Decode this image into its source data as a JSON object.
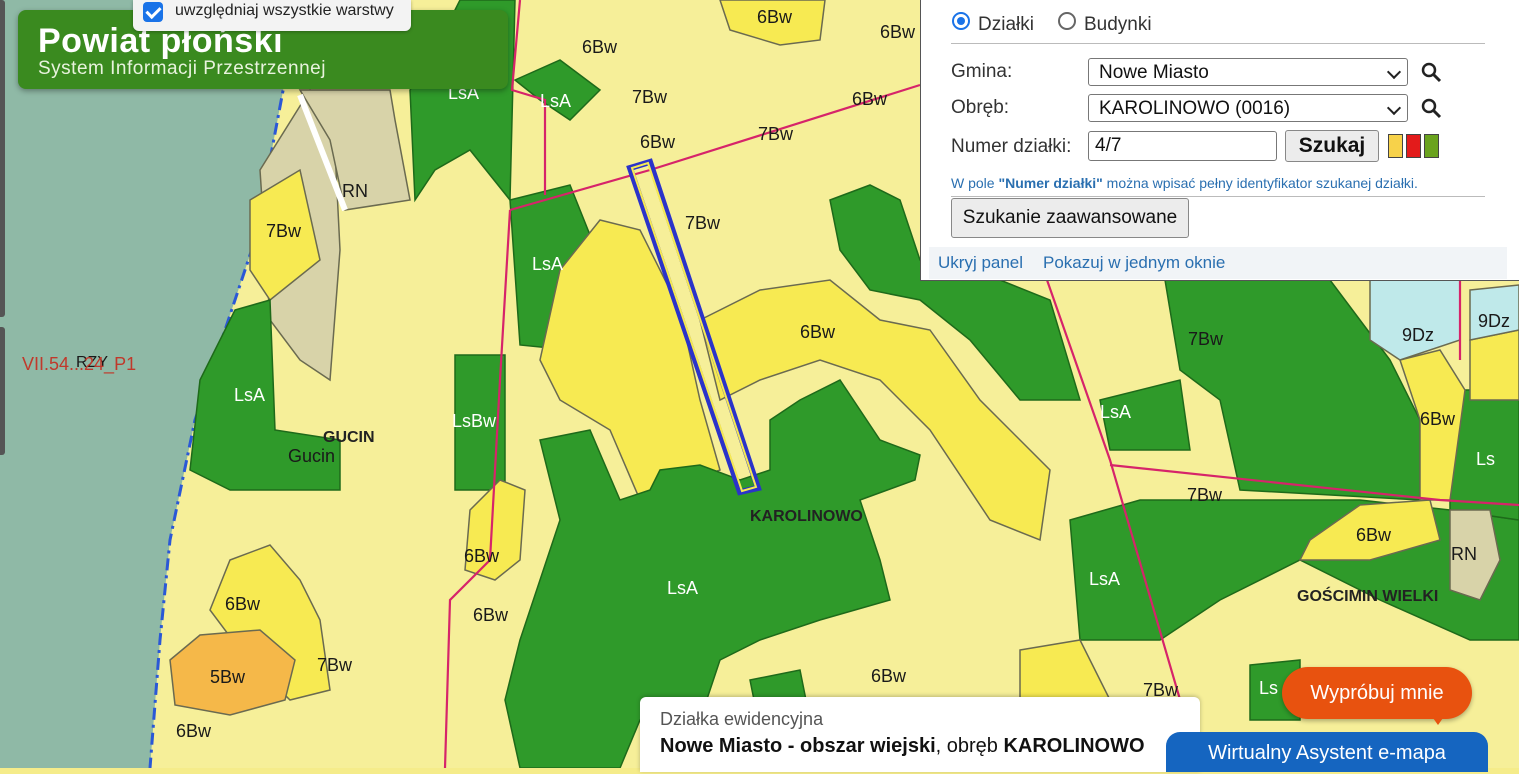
{
  "header": {
    "title": "Powiat płoński",
    "subtitle": "System Informacji Przestrzennej"
  },
  "layers": {
    "label": "uwzględniaj wszystkie warstwy",
    "checked": true
  },
  "search_panel": {
    "mode_parcels": "Działki",
    "mode_buildings": "Budynki",
    "selected_mode": "Działki",
    "gmina_label": "Gmina:",
    "gmina_value": "Nowe Miasto",
    "obreb_label": "Obręb:",
    "obreb_value": "KAROLINOWO (0016)",
    "numer_label": "Numer działki:",
    "numer_value": "4/7",
    "search_button": "Szukaj",
    "hint_prefix": "W pole ",
    "hint_bold": "\"Numer działki\"",
    "hint_suffix": " można wpisać pełny identyfikator szukanej działki.",
    "advanced_button": "Szukanie zaawansowane",
    "hide_panel_link": "Ukryj panel",
    "single_window_link": "Pokazuj w jednym oknie",
    "swatch_colors": [
      "#f7d24a",
      "#e31b1b",
      "#6aa31e"
    ]
  },
  "info_box": {
    "heading": "Działka ewidencyjna",
    "gmina_bold": "Nowe Miasto - obszar wiejski",
    "mid_text": ", obręb ",
    "obreb_bold": "KAROLINOWO"
  },
  "assistant": {
    "label": "Wirtualny Asystent e-mapa",
    "try_label": "Wypróbuj mnie"
  },
  "map": {
    "colors": {
      "water": "#8fb9a6",
      "light_yellow": "#f6ef99",
      "yellow": "#f7ea52",
      "forest": "#2f9a2a",
      "meadow": "#d8d3a9",
      "orange": "#f5b849",
      "cyan": "#bfe9ea",
      "boundary_red": "#d6246a",
      "selected_blue": "#2b33c9"
    },
    "labels": {
      "l_6bw_a": "6Bw",
      "l_6bw_b": "6Bw",
      "l_6bw_c": "6Bw",
      "l_6bw_d": "6Bw",
      "l_6bw_e": "6Bw",
      "l_6bw_f": "6Bw",
      "l_6bw_g": "6Bw",
      "l_6bw_h": "6Bw",
      "l_6bw_i": "6Bw",
      "l_6bw_j": "6Bw",
      "l_6bw_k": "6Bw",
      "l_6bw_l": "6Bw",
      "l_6bw_m": "6Bw",
      "l_7bw_a": "7Bw",
      "l_7bw_b": "7Bw",
      "l_7bw_c": "7Bw",
      "l_7bw_d": "7Bw",
      "l_7bw_e": "7Bw",
      "l_7bw_f": "7Bw",
      "l_7bw_g": "7Bw",
      "l_7bw_h": "7Bw",
      "l_5bw": "5Bw",
      "l_lsa_a": "LsA",
      "l_lsa_b": "LsA",
      "l_lsa_c": "LsA",
      "l_lsa_d": "LsA",
      "l_lsa_e": "LsA",
      "l_lsa_f": "LsA",
      "l_lsa_g": "LsA",
      "l_lsbw": "LsBw",
      "l_ls_a": "Ls",
      "l_ls_b": "Ls",
      "l_rn_a": "RN",
      "l_rn_b": "RN",
      "l_9dz_a": "9Dz",
      "l_9dz_b": "9Dz",
      "l_gucin_caps": "GUCIN",
      "l_gucin": "Gucin",
      "l_karolinowo": "KAROLINOWO",
      "l_goscimin": "GOŚCIMIN WIELKI",
      "l_rzy": "RZY",
      "l_ref": "VII.54...24_P1"
    }
  }
}
